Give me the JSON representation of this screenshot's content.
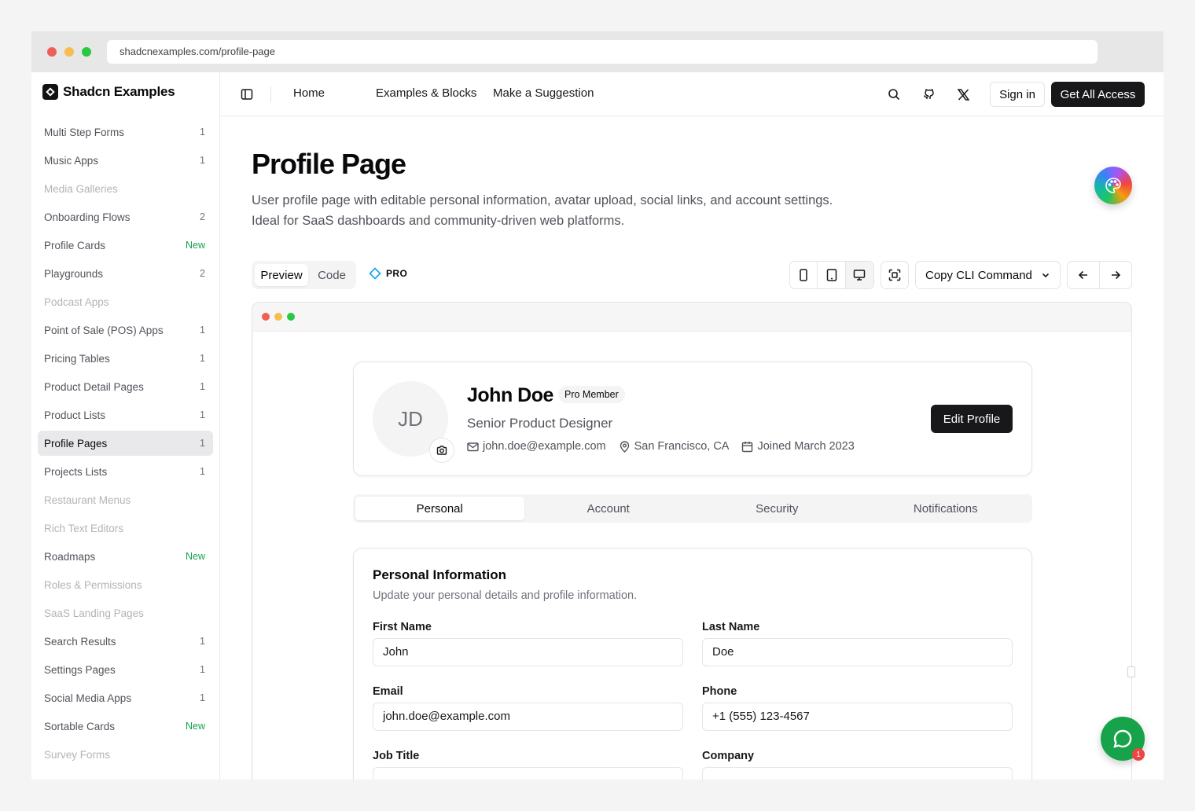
{
  "browser": {
    "url": "shadcnexamples.com/profile-page",
    "dots": [
      "#ee5f57",
      "#f5be4f",
      "#28c840"
    ]
  },
  "sidebar": {
    "brand": "Shadcn Examples",
    "items": [
      {
        "label": "Multi Step Forms",
        "count": "1",
        "state": "normal"
      },
      {
        "label": "Music Apps",
        "count": "1",
        "state": "normal"
      },
      {
        "label": "Media Galleries",
        "count": "",
        "state": "dim"
      },
      {
        "label": "Onboarding Flows",
        "count": "2",
        "state": "normal"
      },
      {
        "label": "Profile Cards",
        "count": "New",
        "state": "new"
      },
      {
        "label": "Playgrounds",
        "count": "2",
        "state": "normal"
      },
      {
        "label": "Podcast Apps",
        "count": "",
        "state": "dim"
      },
      {
        "label": "Point of Sale (POS) Apps",
        "count": "1",
        "state": "normal"
      },
      {
        "label": "Pricing Tables",
        "count": "1",
        "state": "normal"
      },
      {
        "label": "Product Detail Pages",
        "count": "1",
        "state": "normal"
      },
      {
        "label": "Product Lists",
        "count": "1",
        "state": "normal"
      },
      {
        "label": "Profile Pages",
        "count": "1",
        "state": "active"
      },
      {
        "label": "Projects Lists",
        "count": "1",
        "state": "normal"
      },
      {
        "label": "Restaurant Menus",
        "count": "",
        "state": "dim"
      },
      {
        "label": "Rich Text Editors",
        "count": "",
        "state": "dim"
      },
      {
        "label": "Roadmaps",
        "count": "New",
        "state": "new"
      },
      {
        "label": "Roles & Permissions",
        "count": "",
        "state": "dim"
      },
      {
        "label": "SaaS Landing Pages",
        "count": "",
        "state": "dim"
      },
      {
        "label": "Search Results",
        "count": "1",
        "state": "normal"
      },
      {
        "label": "Settings Pages",
        "count": "1",
        "state": "normal"
      },
      {
        "label": "Social Media Apps",
        "count": "1",
        "state": "normal"
      },
      {
        "label": "Sortable Cards",
        "count": "New",
        "state": "new"
      },
      {
        "label": "Survey Forms",
        "count": "",
        "state": "dim"
      }
    ]
  },
  "topnav": {
    "links": [
      "Home",
      "Examples & Blocks",
      "Make a Suggestion"
    ],
    "icons": [
      "search-icon",
      "github-icon",
      "x-icon",
      "theme-icon"
    ],
    "signin": "Sign in",
    "cta": "Get All Access"
  },
  "page": {
    "title": "Profile Page",
    "description_line1": "User profile page with editable personal information, avatar upload, social links, and account settings.",
    "description_line2": "Ideal for SaaS dashboards and community-driven web platforms."
  },
  "toolbar": {
    "tab_preview": "Preview",
    "tab_code": "Code",
    "pro": "PRO",
    "cli": "Copy CLI Command"
  },
  "profile": {
    "initials": "JD",
    "name": "John Doe",
    "badge": "Pro Member",
    "role": "Senior Product Designer",
    "email": "john.doe@example.com",
    "location": "San Francisco, CA",
    "joined": "Joined March 2023",
    "edit": "Edit Profile"
  },
  "tabs": [
    "Personal",
    "Account",
    "Security",
    "Notifications"
  ],
  "form": {
    "title": "Personal Information",
    "description": "Update your personal details and profile information.",
    "first_name_label": "First Name",
    "first_name_value": "John",
    "last_name_label": "Last Name",
    "last_name_value": "Doe",
    "email_label": "Email",
    "email_value": "john.doe@example.com",
    "phone_label": "Phone",
    "phone_value": "+1 (555) 123-4567",
    "job_title_label": "Job Title",
    "company_label": "Company"
  },
  "chat": {
    "badge": "1"
  }
}
